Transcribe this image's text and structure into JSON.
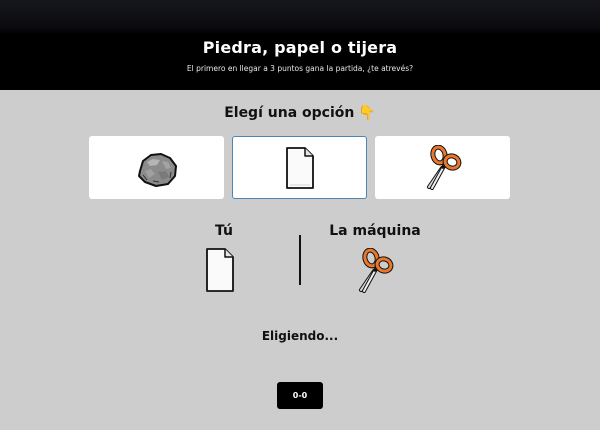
{
  "header": {
    "title": "Piedra, papel o tijera",
    "subtitle": "El primero en llegar a 3 puntos gana la partida, ¿te atrevés?"
  },
  "prompt": {
    "text": "Elegí una opción",
    "hand_glyph": "👇"
  },
  "options": [
    {
      "id": "rock",
      "icon": "rock-icon",
      "selected": false
    },
    {
      "id": "paper",
      "icon": "paper-icon",
      "selected": true
    },
    {
      "id": "scissors",
      "icon": "scissors-icon",
      "selected": false
    }
  ],
  "players": {
    "you_label": "Tú",
    "machine_label": "La máquina",
    "you_choice": "paper-icon",
    "machine_choice": "scissors-icon"
  },
  "status": "Eligiendo...",
  "score": "0-0",
  "colors": {
    "background": "#cdcdcd",
    "header": "#000000",
    "selected_border": "#4a86b8",
    "scissors_handle": "#e8782b"
  }
}
